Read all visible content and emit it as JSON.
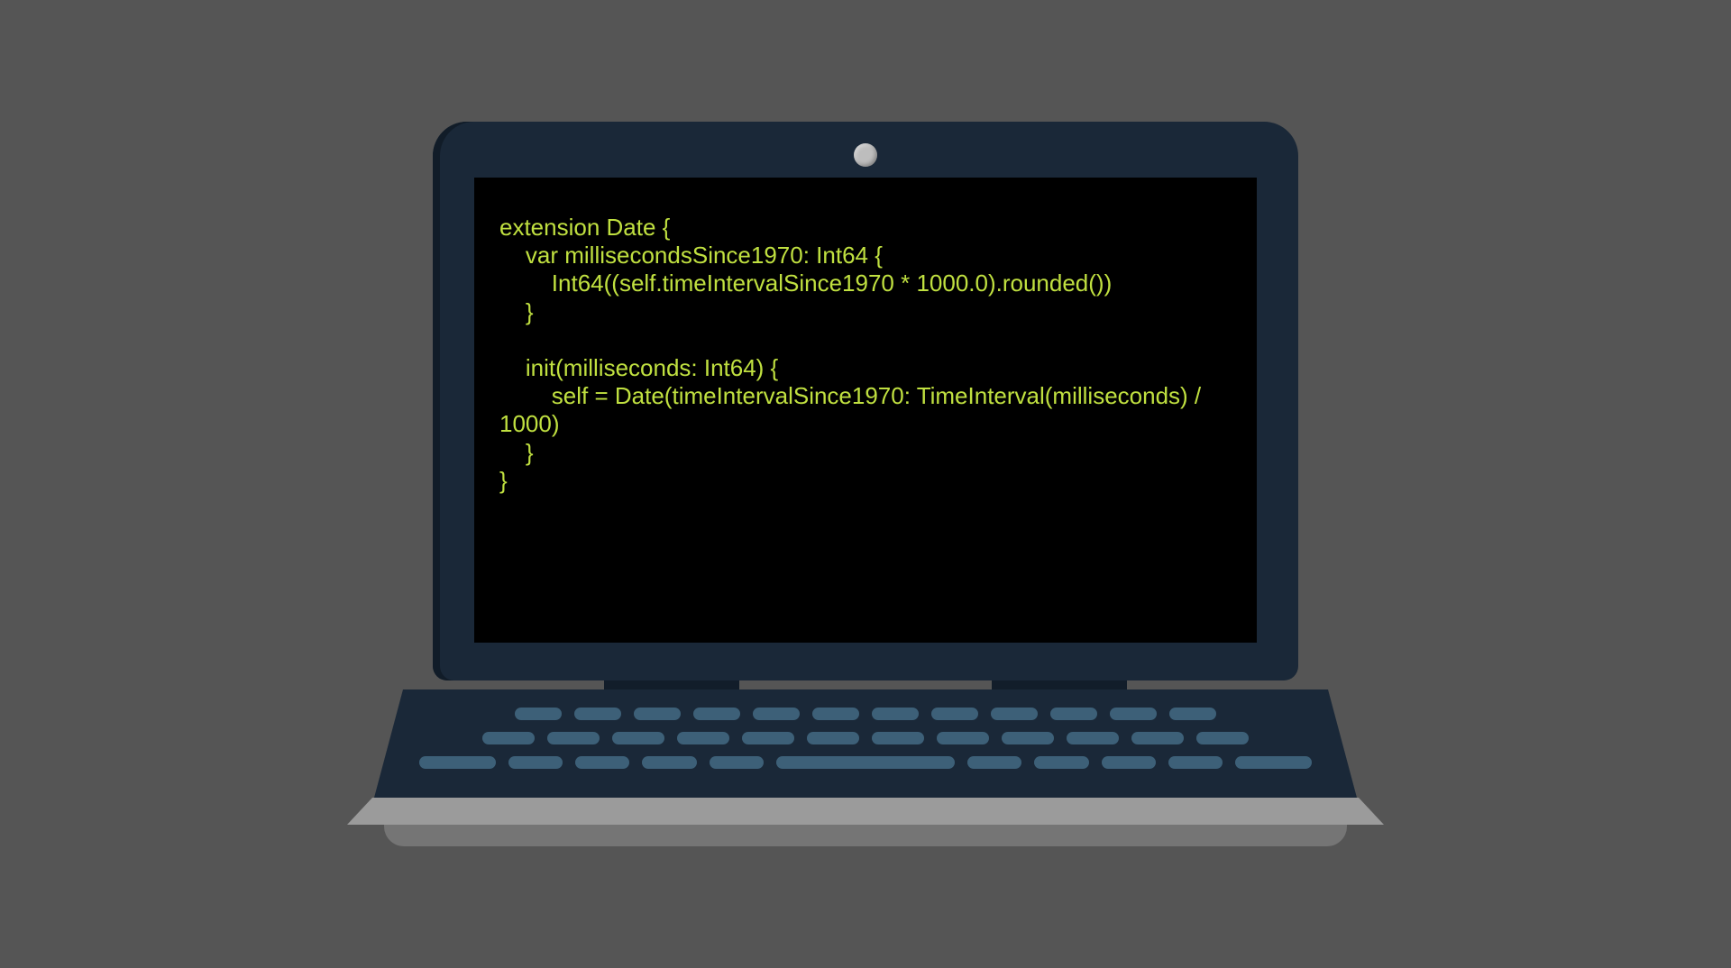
{
  "code": {
    "line1": "extension Date {",
    "line2": "    var millisecondsSince1970: Int64 {",
    "line3": "        Int64((self.timeIntervalSince1970 * 1000.0).rounded())",
    "line4": "    }",
    "line5": "",
    "line6": "    init(milliseconds: Int64) {",
    "line7": "        self = Date(timeIntervalSince1970: TimeInterval(milliseconds) / 1000)",
    "line8": "    }",
    "line9": "}"
  }
}
